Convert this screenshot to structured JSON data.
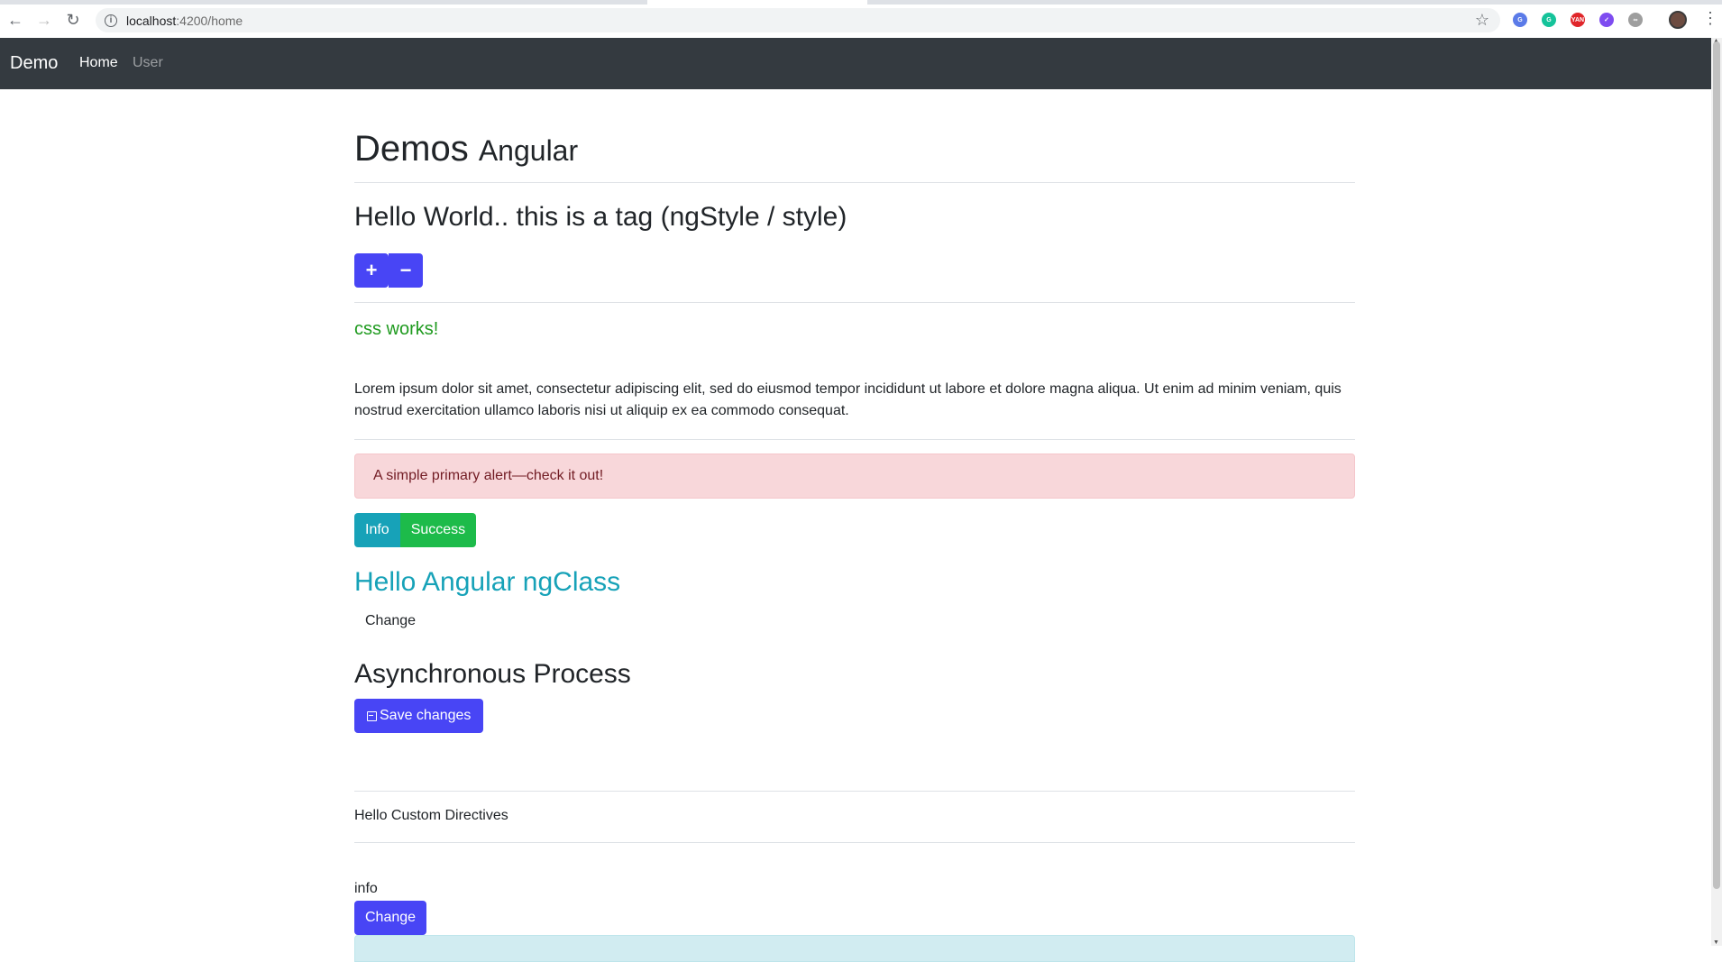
{
  "browser": {
    "url_host": "localhost",
    "url_path": ":4200/home",
    "extensions": [
      {
        "name": "translate-icon",
        "color": "#5b7be8",
        "glyph": "G"
      },
      {
        "name": "grammarly-icon",
        "color": "#15c39a",
        "glyph": "G"
      },
      {
        "name": "yandex-icon",
        "color": "#e0262a",
        "glyph": "YAN"
      },
      {
        "name": "check-extension-icon",
        "color": "#7e4cf0",
        "glyph": "✓"
      },
      {
        "name": "infinity-extension-icon",
        "color": "#9e9e9e",
        "glyph": "∞"
      }
    ]
  },
  "navbar": {
    "brand": "Demo",
    "links": [
      {
        "label": "Home",
        "active": true
      },
      {
        "label": "User",
        "active": false
      }
    ]
  },
  "main": {
    "title": "Demos",
    "subtitle": "Angular",
    "hello_style": "Hello World.. this is a tag (ngStyle / style)",
    "plus_label": "+",
    "minus_label": "−",
    "css_works": "css works!",
    "lorem": "Lorem ipsum dolor sit amet, consectetur adipiscing elit, sed do eiusmod tempor incididunt ut labore et dolore magna aliqua. Ut enim ad minim veniam, quis nostrud exercitation ullamco laboris nisi ut aliquip ex ea commodo consequat.",
    "alert": "A simple primary alert—check it out!",
    "info_button": "Info",
    "success_button": "Success",
    "ngclass_title": "Hello Angular ngClass",
    "change_link": "Change",
    "async_title": "Asynchronous Process",
    "save_button": "Save changes",
    "custom_directives": "Hello Custom Directives",
    "info_text": "info",
    "change_button": "Change"
  },
  "colors": {
    "primary_button": "#4845f5",
    "navbar_bg": "#343a40",
    "info": "#17a2b8",
    "success": "#1dbb4a",
    "css_works_text": "#1e9a1e",
    "alert_bg": "#f8d7da"
  }
}
